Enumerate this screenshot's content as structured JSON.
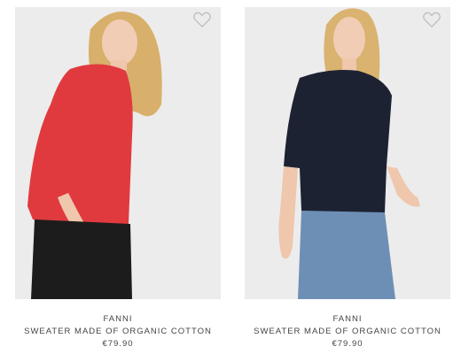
{
  "products": [
    {
      "brand": "FANNI",
      "name": "SWEATER MADE OF ORGANIC COTTON",
      "price": "€79.90",
      "sweater_color": "#e03a3f",
      "bottom_color": "#1c1c1c"
    },
    {
      "brand": "FANNI",
      "name": "SWEATER MADE OF ORGANIC COTTON",
      "price": "€79.90",
      "sweater_color": "#1d2233",
      "bottom_color": "#6e8fb5"
    }
  ],
  "icons": {
    "wishlist": "heart-outline-icon"
  }
}
